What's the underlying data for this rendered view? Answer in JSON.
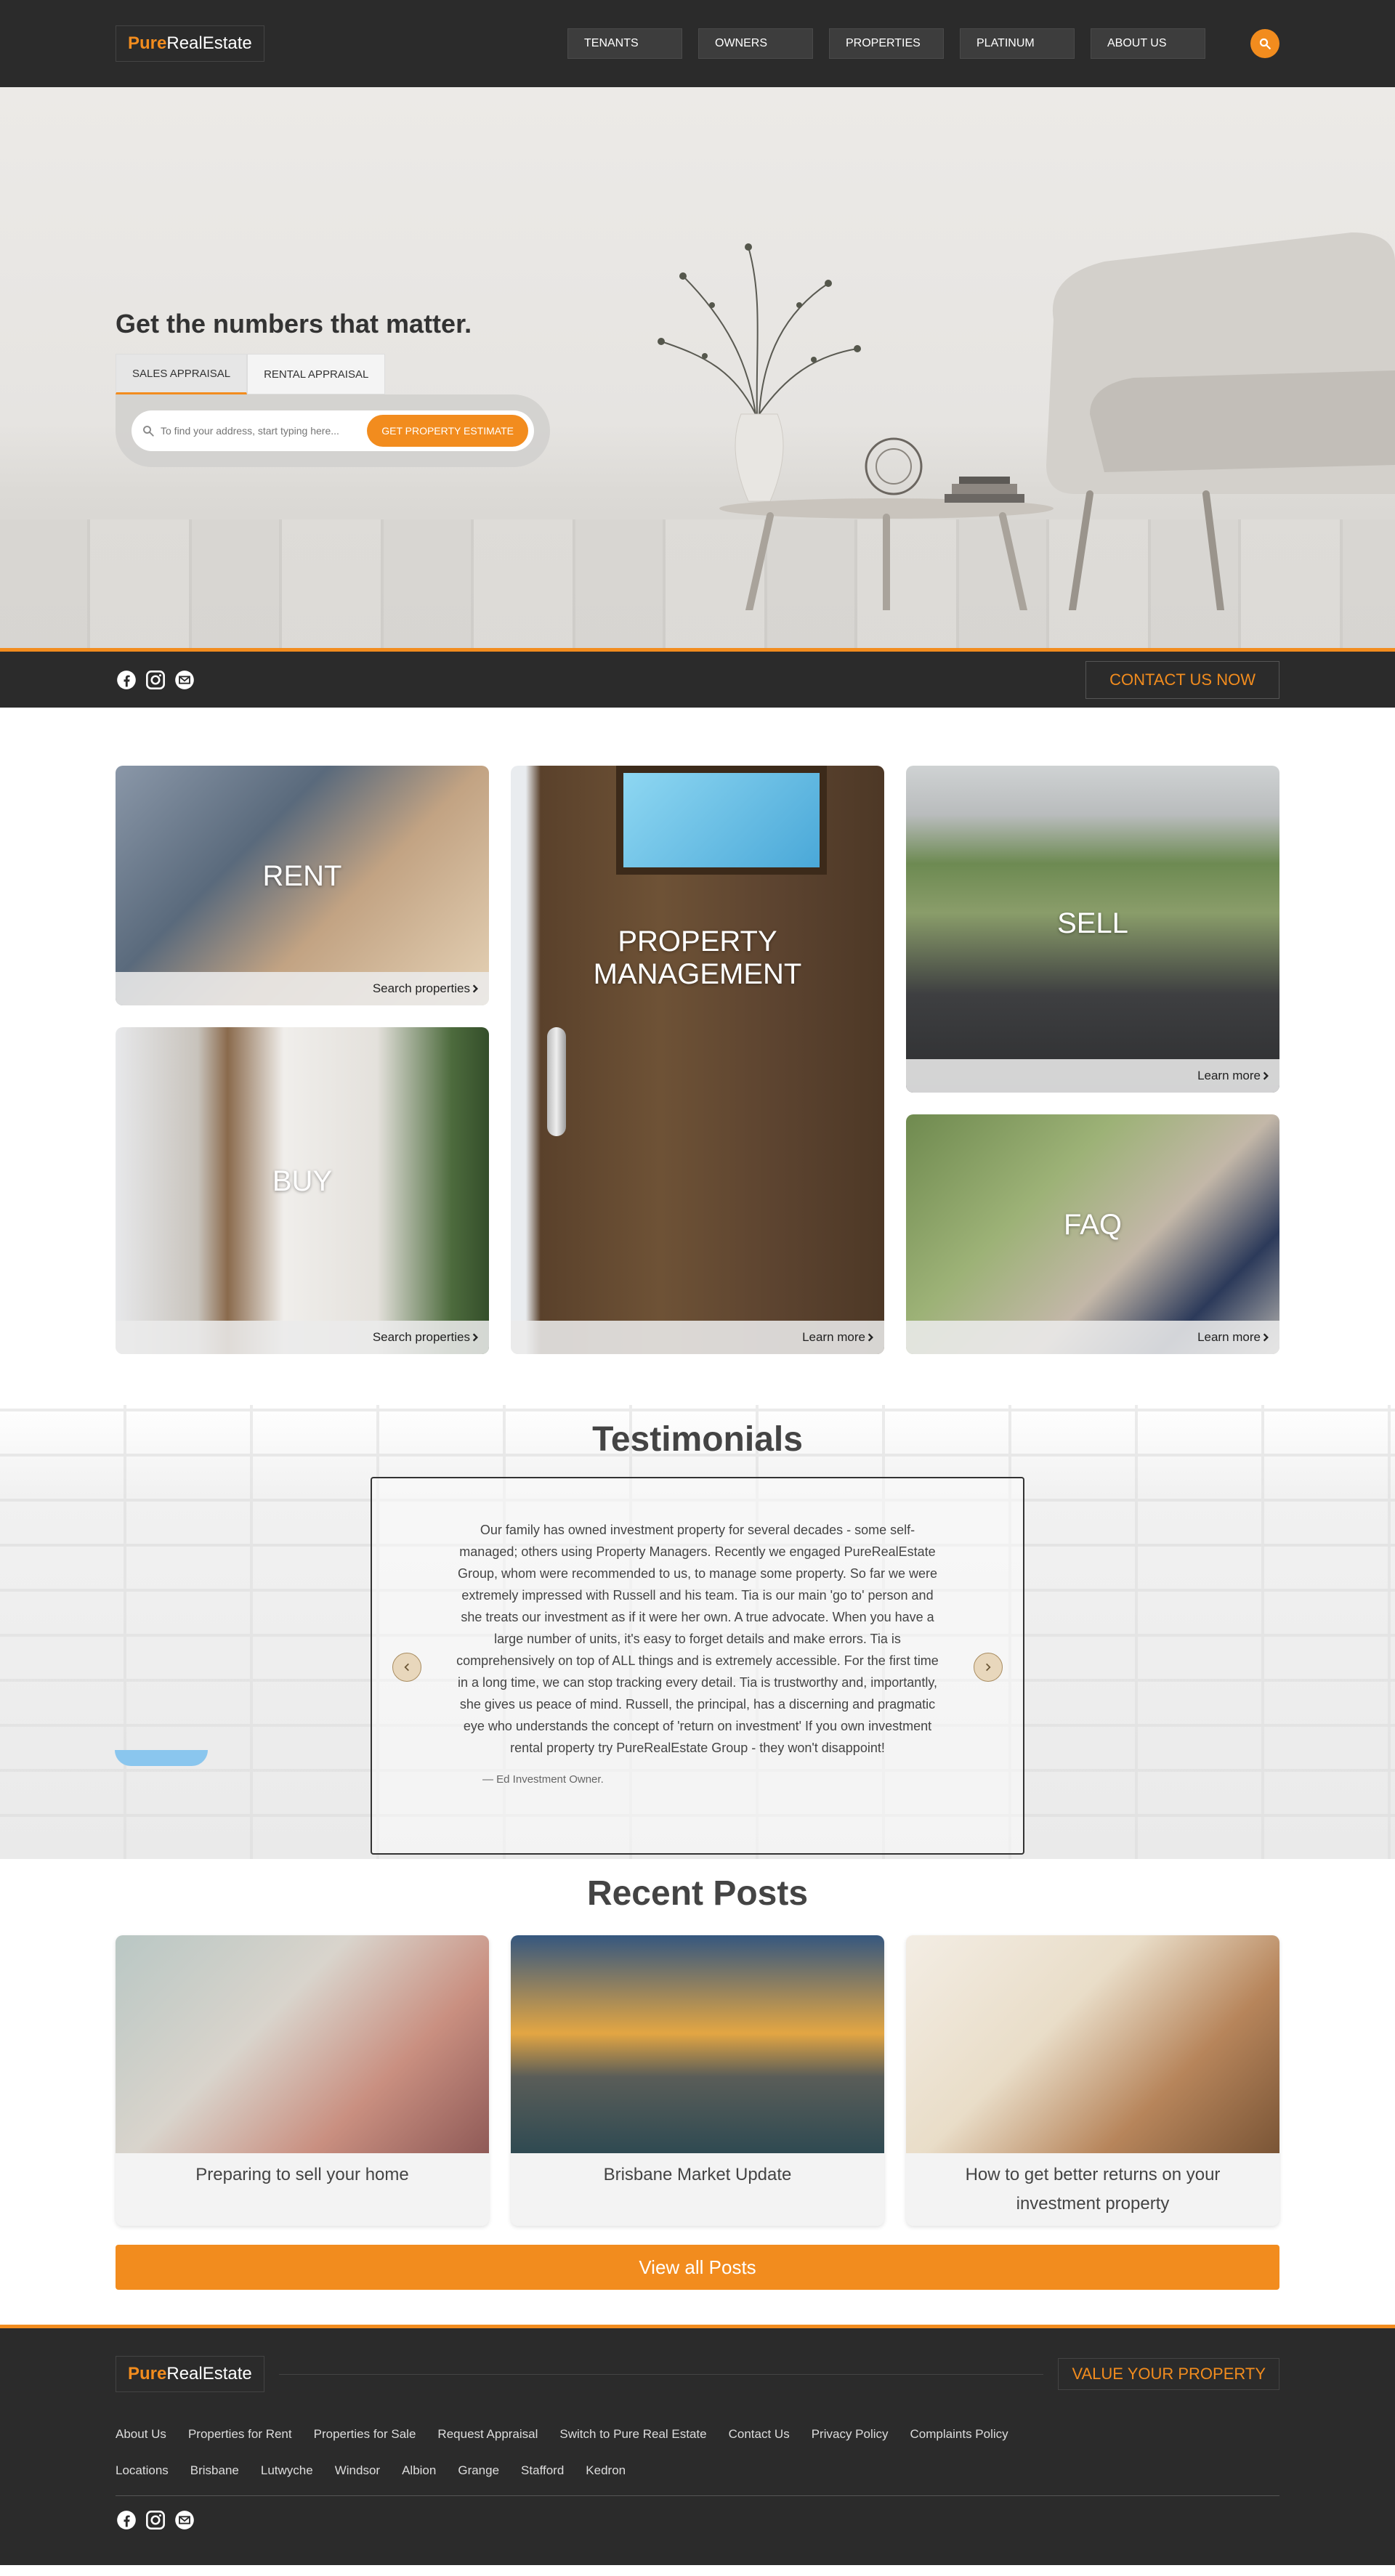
{
  "brand": {
    "pure": "Pure",
    "rest": "RealEstate"
  },
  "nav": {
    "items": [
      "TENANTS",
      "OWNERS",
      "PROPERTIES",
      "PLATINUM",
      "ABOUT US"
    ]
  },
  "hero": {
    "title": "Get the numbers that matter.",
    "tabs": [
      "SALES APPRAISAL",
      "RENTAL APPRAISAL"
    ],
    "search_placeholder": "To find your address, start typing here...",
    "cta": "GET PROPERTY ESTIMATE"
  },
  "socialbar": {
    "contact": "CONTACT US NOW"
  },
  "services": {
    "rent": {
      "title": "RENT",
      "link": "Search properties"
    },
    "buy": {
      "title": "BUY",
      "link": "Search properties"
    },
    "management": {
      "title": "PROPERTY MANAGEMENT",
      "link": "Learn more"
    },
    "sell": {
      "title": "SELL",
      "link": "Learn more"
    },
    "faq": {
      "title": "FAQ",
      "link": "Learn more"
    }
  },
  "testimonials": {
    "title": "Testimonials",
    "text": "Our family has owned investment property for several decades - some self-managed; others using Property Managers. Recently we engaged PureRealEstate Group, whom were recommended to us, to manage some property. So far we were extremely impressed with Russell and his team. Tia is our main 'go to' person and she treats our investment as if it were her own. A true advocate. When you have a large number of units, it's easy to forget details and make errors. Tia is comprehensively on top of ALL things and is extremely accessible. For the first time in a long time, we can stop tracking every detail. Tia is trustworthy and, importantly, she gives us peace of mind. Russell, the principal, has a discerning and pragmatic eye who understands the concept of 'return on investment' If you own investment rental property try PureRealEstate Group - they won't disappoint!",
    "author": "— Ed Investment Owner."
  },
  "posts": {
    "title": "Recent Posts",
    "items": [
      {
        "title": "Preparing to sell your home"
      },
      {
        "title": "Brisbane Market Update"
      },
      {
        "title": "How to get better returns on your investment property"
      }
    ],
    "view_all": "View all Posts"
  },
  "footer": {
    "value_btn": "VALUE YOUR PROPERTY",
    "links_row1": [
      "About Us",
      "Properties for Rent",
      "Properties for Sale",
      "Request Appraisal",
      "Switch to Pure Real Estate",
      "Contact Us",
      "Privacy Policy",
      "Complaints Policy"
    ],
    "links_row2": [
      "Locations",
      "Brisbane",
      "Lutwyche",
      "Windsor",
      "Albion",
      "Grange",
      "Stafford",
      "Kedron"
    ]
  },
  "colors": {
    "accent": "#f28c1e",
    "dark": "#2b2b2b"
  },
  "icons": [
    "search-icon",
    "facebook-icon",
    "instagram-icon",
    "email-icon",
    "chevron-right-icon",
    "chevron-left-icon"
  ]
}
